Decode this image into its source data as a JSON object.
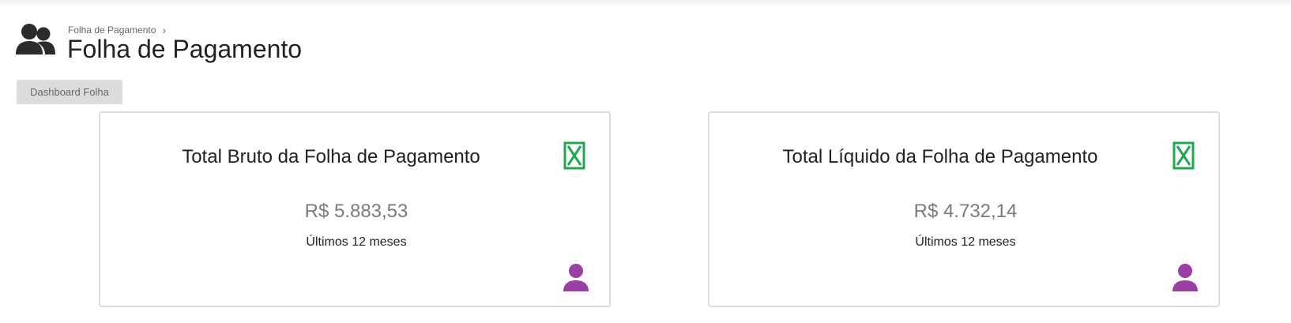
{
  "header": {
    "breadcrumb": "Folha de Pagamento",
    "breadcrumb_separator": "›",
    "title": "Folha de Pagamento",
    "icon": "users-icon"
  },
  "tabs": [
    {
      "label": "Dashboard Folha",
      "active": true
    }
  ],
  "cards": [
    {
      "title": "Total Bruto da Folha de Pagamento",
      "value": "R$ 5.883,53",
      "subtitle": "Últimos 12 meses",
      "export_icon": "excel-export-icon",
      "footer_icon": "user-icon"
    },
    {
      "title": "Total Líquido da Folha de Pagamento",
      "value": "R$ 4.732,14",
      "subtitle": "Últimos 12 meses",
      "export_icon": "excel-export-icon",
      "footer_icon": "user-icon"
    }
  ],
  "colors": {
    "accent_green": "#1fa850",
    "accent_purple": "#9b3fa5",
    "title_text": "#222222",
    "muted_text": "#7a7a7a"
  }
}
